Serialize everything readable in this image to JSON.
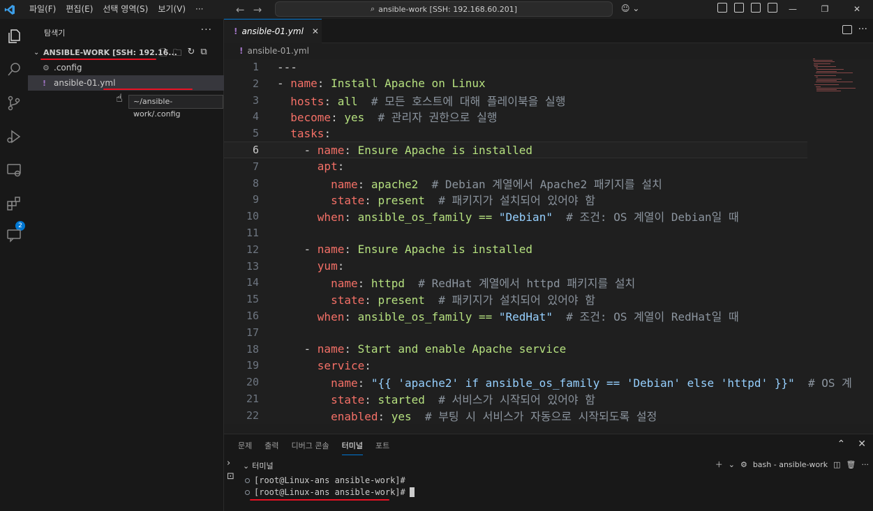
{
  "titlebar": {
    "menu": [
      "파일(F)",
      "편집(E)",
      "선택 영역(S)",
      "보기(V)",
      "···"
    ],
    "search": "ansible-work [SSH: 192.168.60.201]",
    "copilot": "⌄"
  },
  "sidebar": {
    "title": "탐색기",
    "folder": "ANSIBLE-WORK [SSH: 192.16...",
    "items": [
      {
        "name": ".config",
        "icon": "gear-icon"
      },
      {
        "name": "ansible-01.yml",
        "icon": "yaml-icon"
      }
    ],
    "tooltip": "~/ansible-work/.config",
    "badge": "2"
  },
  "editor": {
    "tab": "ansible-01.yml",
    "breadcrumb": "ansible-01.yml",
    "current_line": 6,
    "lines": [
      {
        "n": "1",
        "tokens": [
          {
            "t": "---",
            "c": "d"
          }
        ]
      },
      {
        "n": "2",
        "tokens": [
          {
            "t": "- ",
            "c": "d"
          },
          {
            "t": "name",
            "c": "k"
          },
          {
            "t": ": ",
            "c": "d"
          },
          {
            "t": "Install Apache on Linux",
            "c": "v"
          }
        ]
      },
      {
        "n": "3",
        "tokens": [
          {
            "t": "  ",
            "c": "d"
          },
          {
            "t": "hosts",
            "c": "k"
          },
          {
            "t": ": ",
            "c": "d"
          },
          {
            "t": "all",
            "c": "v"
          },
          {
            "t": "  # 모든 호스트에 대해 플레이북을 실행",
            "c": "c"
          }
        ]
      },
      {
        "n": "4",
        "tokens": [
          {
            "t": "  ",
            "c": "d"
          },
          {
            "t": "become",
            "c": "k"
          },
          {
            "t": ": ",
            "c": "d"
          },
          {
            "t": "yes",
            "c": "v"
          },
          {
            "t": "  # 관리자 권한으로 실행",
            "c": "c"
          }
        ]
      },
      {
        "n": "5",
        "tokens": [
          {
            "t": "  ",
            "c": "d"
          },
          {
            "t": "tasks",
            "c": "k"
          },
          {
            "t": ":",
            "c": "d"
          }
        ]
      },
      {
        "n": "6",
        "tokens": [
          {
            "t": "    - ",
            "c": "d"
          },
          {
            "t": "name",
            "c": "k"
          },
          {
            "t": ": ",
            "c": "d"
          },
          {
            "t": "Ensure Apache is installed",
            "c": "v"
          }
        ]
      },
      {
        "n": "7",
        "tokens": [
          {
            "t": "      ",
            "c": "d"
          },
          {
            "t": "apt",
            "c": "k"
          },
          {
            "t": ":",
            "c": "d"
          }
        ]
      },
      {
        "n": "8",
        "tokens": [
          {
            "t": "        ",
            "c": "d"
          },
          {
            "t": "name",
            "c": "k"
          },
          {
            "t": ": ",
            "c": "d"
          },
          {
            "t": "apache2",
            "c": "v"
          },
          {
            "t": "  # Debian 계열에서 Apache2 패키지를 설치",
            "c": "c"
          }
        ]
      },
      {
        "n": "9",
        "tokens": [
          {
            "t": "        ",
            "c": "d"
          },
          {
            "t": "state",
            "c": "k"
          },
          {
            "t": ": ",
            "c": "d"
          },
          {
            "t": "present",
            "c": "v"
          },
          {
            "t": "  # 패키지가 설치되어 있어야 함",
            "c": "c"
          }
        ]
      },
      {
        "n": "10",
        "tokens": [
          {
            "t": "      ",
            "c": "d"
          },
          {
            "t": "when",
            "c": "k"
          },
          {
            "t": ": ",
            "c": "d"
          },
          {
            "t": "ansible_os_family == ",
            "c": "v"
          },
          {
            "t": "\"Debian\"",
            "c": "s"
          },
          {
            "t": "  # 조건: OS 계열이 Debian일 때",
            "c": "c"
          }
        ]
      },
      {
        "n": "11",
        "tokens": []
      },
      {
        "n": "12",
        "tokens": [
          {
            "t": "    - ",
            "c": "d"
          },
          {
            "t": "name",
            "c": "k"
          },
          {
            "t": ": ",
            "c": "d"
          },
          {
            "t": "Ensure Apache is installed",
            "c": "v"
          }
        ]
      },
      {
        "n": "13",
        "tokens": [
          {
            "t": "      ",
            "c": "d"
          },
          {
            "t": "yum",
            "c": "k"
          },
          {
            "t": ":",
            "c": "d"
          }
        ]
      },
      {
        "n": "14",
        "tokens": [
          {
            "t": "        ",
            "c": "d"
          },
          {
            "t": "name",
            "c": "k"
          },
          {
            "t": ": ",
            "c": "d"
          },
          {
            "t": "httpd",
            "c": "v"
          },
          {
            "t": "  # RedHat 계열에서 httpd 패키지를 설치",
            "c": "c"
          }
        ]
      },
      {
        "n": "15",
        "tokens": [
          {
            "t": "        ",
            "c": "d"
          },
          {
            "t": "state",
            "c": "k"
          },
          {
            "t": ": ",
            "c": "d"
          },
          {
            "t": "present",
            "c": "v"
          },
          {
            "t": "  # 패키지가 설치되어 있어야 함",
            "c": "c"
          }
        ]
      },
      {
        "n": "16",
        "tokens": [
          {
            "t": "      ",
            "c": "d"
          },
          {
            "t": "when",
            "c": "k"
          },
          {
            "t": ": ",
            "c": "d"
          },
          {
            "t": "ansible_os_family == ",
            "c": "v"
          },
          {
            "t": "\"RedHat\"",
            "c": "s"
          },
          {
            "t": "  # 조건: OS 계열이 RedHat일 때",
            "c": "c"
          }
        ]
      },
      {
        "n": "17",
        "tokens": []
      },
      {
        "n": "18",
        "tokens": [
          {
            "t": "    - ",
            "c": "d"
          },
          {
            "t": "name",
            "c": "k"
          },
          {
            "t": ": ",
            "c": "d"
          },
          {
            "t": "Start and enable Apache service",
            "c": "v"
          }
        ]
      },
      {
        "n": "19",
        "tokens": [
          {
            "t": "      ",
            "c": "d"
          },
          {
            "t": "service",
            "c": "k"
          },
          {
            "t": ":",
            "c": "d"
          }
        ]
      },
      {
        "n": "20",
        "tokens": [
          {
            "t": "        ",
            "c": "d"
          },
          {
            "t": "name",
            "c": "k"
          },
          {
            "t": ": ",
            "c": "d"
          },
          {
            "t": "\"{{ 'apache2' if ansible_os_family == 'Debian' else 'httpd' }}\"",
            "c": "s"
          },
          {
            "t": "  # OS 계",
            "c": "c"
          }
        ]
      },
      {
        "n": "21",
        "tokens": [
          {
            "t": "        ",
            "c": "d"
          },
          {
            "t": "state",
            "c": "k"
          },
          {
            "t": ": ",
            "c": "d"
          },
          {
            "t": "started",
            "c": "v"
          },
          {
            "t": "  # 서비스가 시작되어 있어야 함",
            "c": "c"
          }
        ]
      },
      {
        "n": "22",
        "tokens": [
          {
            "t": "        ",
            "c": "d"
          },
          {
            "t": "enabled",
            "c": "k"
          },
          {
            "t": ": ",
            "c": "d"
          },
          {
            "t": "yes",
            "c": "v"
          },
          {
            "t": "  # 부팅 시 서비스가 자동으로 시작되도록 설정",
            "c": "c"
          }
        ]
      }
    ]
  },
  "panel": {
    "tabs": [
      "문제",
      "출력",
      "디버그 콘솔",
      "터미널",
      "포트"
    ],
    "active_tab": "터미널",
    "terminal_title": "터미널",
    "terminal_name": "bash - ansible-work",
    "lines": [
      "[root@Linux-ans ansible-work]#",
      "[root@Linux-ans ansible-work]#"
    ]
  },
  "colors": {
    "accent": "#0078d4",
    "annotation": "#e81123"
  }
}
